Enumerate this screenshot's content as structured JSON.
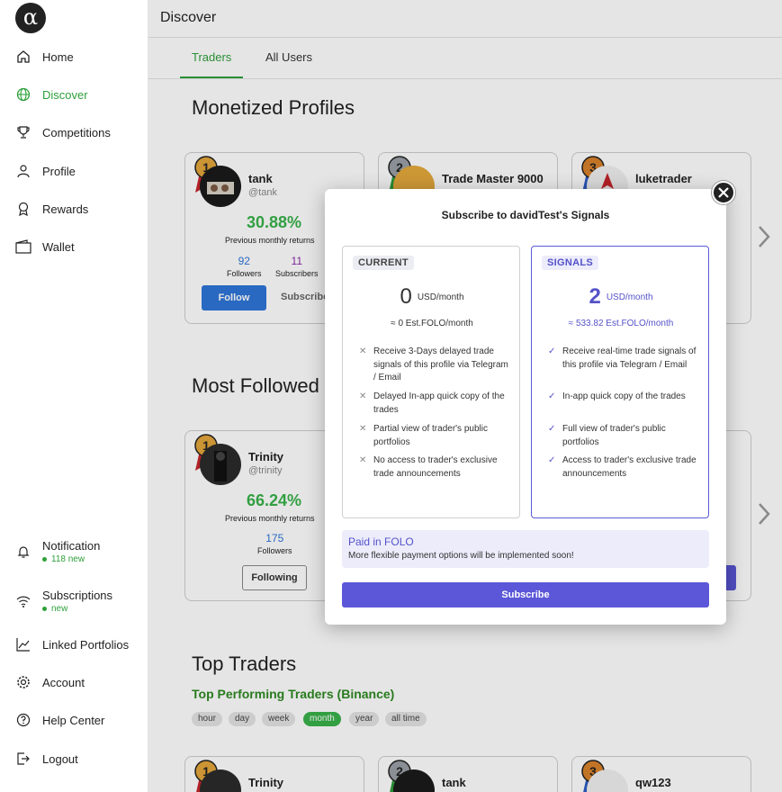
{
  "app": {
    "logo_glyph": "α",
    "page_title": "Discover"
  },
  "sidebar": {
    "items": [
      {
        "label": "Home",
        "icon": "home-icon"
      },
      {
        "label": "Discover",
        "icon": "globe-icon",
        "active": true
      },
      {
        "label": "Competitions",
        "icon": "trophy-icon"
      },
      {
        "label": "Profile",
        "icon": "person-icon"
      },
      {
        "label": "Rewards",
        "icon": "award-icon"
      },
      {
        "label": "Wallet",
        "icon": "wallet-icon"
      }
    ],
    "bottom_items": [
      {
        "label": "Notification",
        "icon": "bell-icon",
        "sub": "118 new"
      },
      {
        "label": "Subscriptions",
        "icon": "wifi-icon",
        "sub": "new"
      },
      {
        "label": "Linked Portfolios",
        "icon": "chart-line-icon"
      },
      {
        "label": "Account",
        "icon": "gear-icon"
      },
      {
        "label": "Help Center",
        "icon": "help-icon"
      },
      {
        "label": "Logout",
        "icon": "logout-icon"
      }
    ]
  },
  "tabs": [
    {
      "label": "Traders",
      "active": true
    },
    {
      "label": "All Users"
    }
  ],
  "sections": {
    "monetized": "Monetized Profiles",
    "most_followed": "Most Followed",
    "top_traders": "Top Traders",
    "top_performing": "Top Performing Traders (Binance)"
  },
  "monetized_cards": [
    {
      "rank": "1",
      "name": "tank",
      "handle": "@tank",
      "pct": "30.88%",
      "pct_label": "Previous monthly returns",
      "followers": "92",
      "followers_label": "Followers",
      "subscribers": "11",
      "subscribers_label": "Subscribers",
      "follow_label": "Follow",
      "subscribe_label": "Subscribe"
    },
    {
      "rank": "2",
      "name": "Trade Master 9000"
    },
    {
      "rank": "3",
      "name": "luketrader"
    }
  ],
  "followed_cards": [
    {
      "rank": "1",
      "name": "Trinity",
      "handle": "@trinity",
      "pct": "66.24%",
      "pct_label": "Previous monthly returns",
      "followers": "175",
      "followers_label": "Followers",
      "following_label": "Following"
    }
  ],
  "top_cards": [
    {
      "rank": "1",
      "name": "Trinity"
    },
    {
      "rank": "2",
      "name": "tank"
    },
    {
      "rank": "3",
      "name": "qw123"
    }
  ],
  "periods": [
    "hour",
    "day",
    "week",
    "month",
    "year",
    "all time"
  ],
  "active_period": "month",
  "modal": {
    "title": "Subscribe to davidTest's Signals",
    "current": {
      "tag": "CURRENT",
      "price": "0",
      "unit": "USD/month",
      "est": "≈ 0 Est.FOLO/month",
      "features": [
        "Receive 3-Days delayed trade signals of this profile via Telegram / Email",
        "Delayed In-app quick copy of the trades",
        "Partial view of trader's public portfolios",
        "No access to trader's exclusive trade announcements"
      ]
    },
    "signals": {
      "tag": "SIGNALS",
      "price": "2",
      "unit": "USD/month",
      "est": "≈ 533.82 Est.FOLO/month",
      "features": [
        "Receive real-time trade signals of this profile via Telegram / Email",
        "In-app quick copy of the trades",
        "Full view of trader's public portfolios",
        "Access to trader's exclusive trade announcements"
      ]
    },
    "paid_title": "Paid in FOLO",
    "paid_sub": "More flexible payment options will be implemented soon!",
    "subscribe_label": "Subscribe"
  },
  "colors": {
    "accent_green": "#2ea03a",
    "follow_blue": "#2e75d9",
    "modal_purple": "#5b57d8"
  }
}
